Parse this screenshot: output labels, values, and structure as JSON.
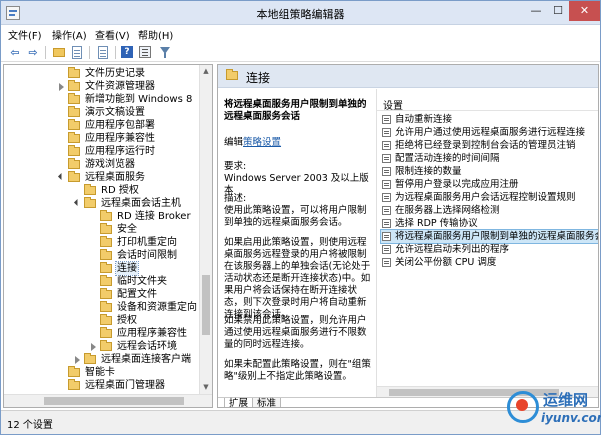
{
  "window": {
    "title": "本地组策略编辑器",
    "buttons": {
      "min": "—",
      "max": "☐",
      "close": "✕"
    }
  },
  "menubar": {
    "items": [
      "文件(F)",
      "操作(A)",
      "查看(V)",
      "帮助(H)"
    ]
  },
  "toolbar": {
    "icons": [
      "back-arrow",
      "forward-arrow",
      "up-folder",
      "show-hide-tree",
      "export-list",
      "help",
      "properties",
      "filter"
    ],
    "back": "⇦",
    "forward": "⇨"
  },
  "tree": {
    "items": [
      {
        "label": "文件历史记录",
        "state": "none"
      },
      {
        "label": "文件资源管理器",
        "state": "collapsed"
      },
      {
        "label": "新增功能到 Windows 8",
        "state": "none"
      },
      {
        "label": "演示文稿设置",
        "state": "none"
      },
      {
        "label": "应用程序包部署",
        "state": "none"
      },
      {
        "label": "应用程序兼容性",
        "state": "none"
      },
      {
        "label": "应用程序运行时",
        "state": "none"
      },
      {
        "label": "游戏浏览器",
        "state": "none"
      },
      {
        "label": "远程桌面服务",
        "state": "expanded"
      },
      {
        "label": "RD 授权",
        "state": "none"
      },
      {
        "label": "远程桌面会话主机",
        "state": "expanded"
      },
      {
        "label": "RD 连接 Broker",
        "state": "none"
      },
      {
        "label": "安全",
        "state": "none"
      },
      {
        "label": "打印机重定向",
        "state": "none"
      },
      {
        "label": "会话时间限制",
        "state": "none"
      },
      {
        "label": "连接",
        "state": "none",
        "selected": true
      },
      {
        "label": "临时文件夹",
        "state": "none"
      },
      {
        "label": "配置文件",
        "state": "none"
      },
      {
        "label": "设备和资源重定向",
        "state": "none"
      },
      {
        "label": "授权",
        "state": "none"
      },
      {
        "label": "应用程序兼容性",
        "state": "none"
      },
      {
        "label": "远程会话环境",
        "state": "collapsed"
      },
      {
        "label": "远程桌面连接客户端",
        "state": "collapsed"
      },
      {
        "label": "智能卡",
        "state": "none"
      },
      {
        "label": "远程桌面门管理器",
        "state": "none"
      }
    ]
  },
  "right_pane": {
    "header_title": "连接",
    "description": {
      "title": "将远程桌面服务用户限制到单独的远程桌面服务会话",
      "edit_prefix": "编辑",
      "edit_link": "策略设置",
      "requirements_label": "要求:",
      "requirements_value": "Windows Server 2003 及以上版本",
      "desc_label": "描述:",
      "desc_text": "使用此策略设置，可以将用户限制到单独的远程桌面服务会话。",
      "para_enabled": "如果启用此策略设置，则使用远程桌面服务远程登录的用户将被限制在该服务器上的单独会话(无论处于活动状态还是断开连接状态)中。如果用户将会话保持在断开连接状态，则下次登录时用户将自动重新连接到该会话。",
      "para_disabled": "如果禁用此策略设置，则允许用户通过使用远程桌面服务进行不限数量的同时远程连接。",
      "para_notconfigured": "如果未配置此策略设置，则在\"组策略\"级别上不指定此策略设置。"
    },
    "list_header": "设置",
    "settings": [
      "自动重新连接",
      "允许用户通过使用远程桌面服务进行远程连接",
      "拒绝将已经登录到控制台会话的管理员注销",
      "配置活动连接的时间间隔",
      "限制连接的数量",
      "暂停用户登录以完成应用注册",
      "为远程桌面服务用户会话远程控制设置规则",
      "在服务器上选择网络检测",
      "选择 RDP 传输协议",
      "将远程桌面服务用户限制到单独的远程桌面服务会",
      "允许远程启动未列出的程序",
      "关闭公平份额 CPU 调度"
    ],
    "selected_setting_index": 9,
    "tabs": [
      "扩展",
      "标准"
    ],
    "active_tab": "扩展"
  },
  "status_bar": {
    "text": "12 个设置"
  },
  "watermark": {
    "cn": "运维网",
    "en": "iyunv.com"
  },
  "colors": {
    "titlebar": "#dde6f4",
    "close_button": "#c75050",
    "folder": "#f2cc6a",
    "selection": "#cde6f7",
    "link": "#1a5aa8"
  }
}
